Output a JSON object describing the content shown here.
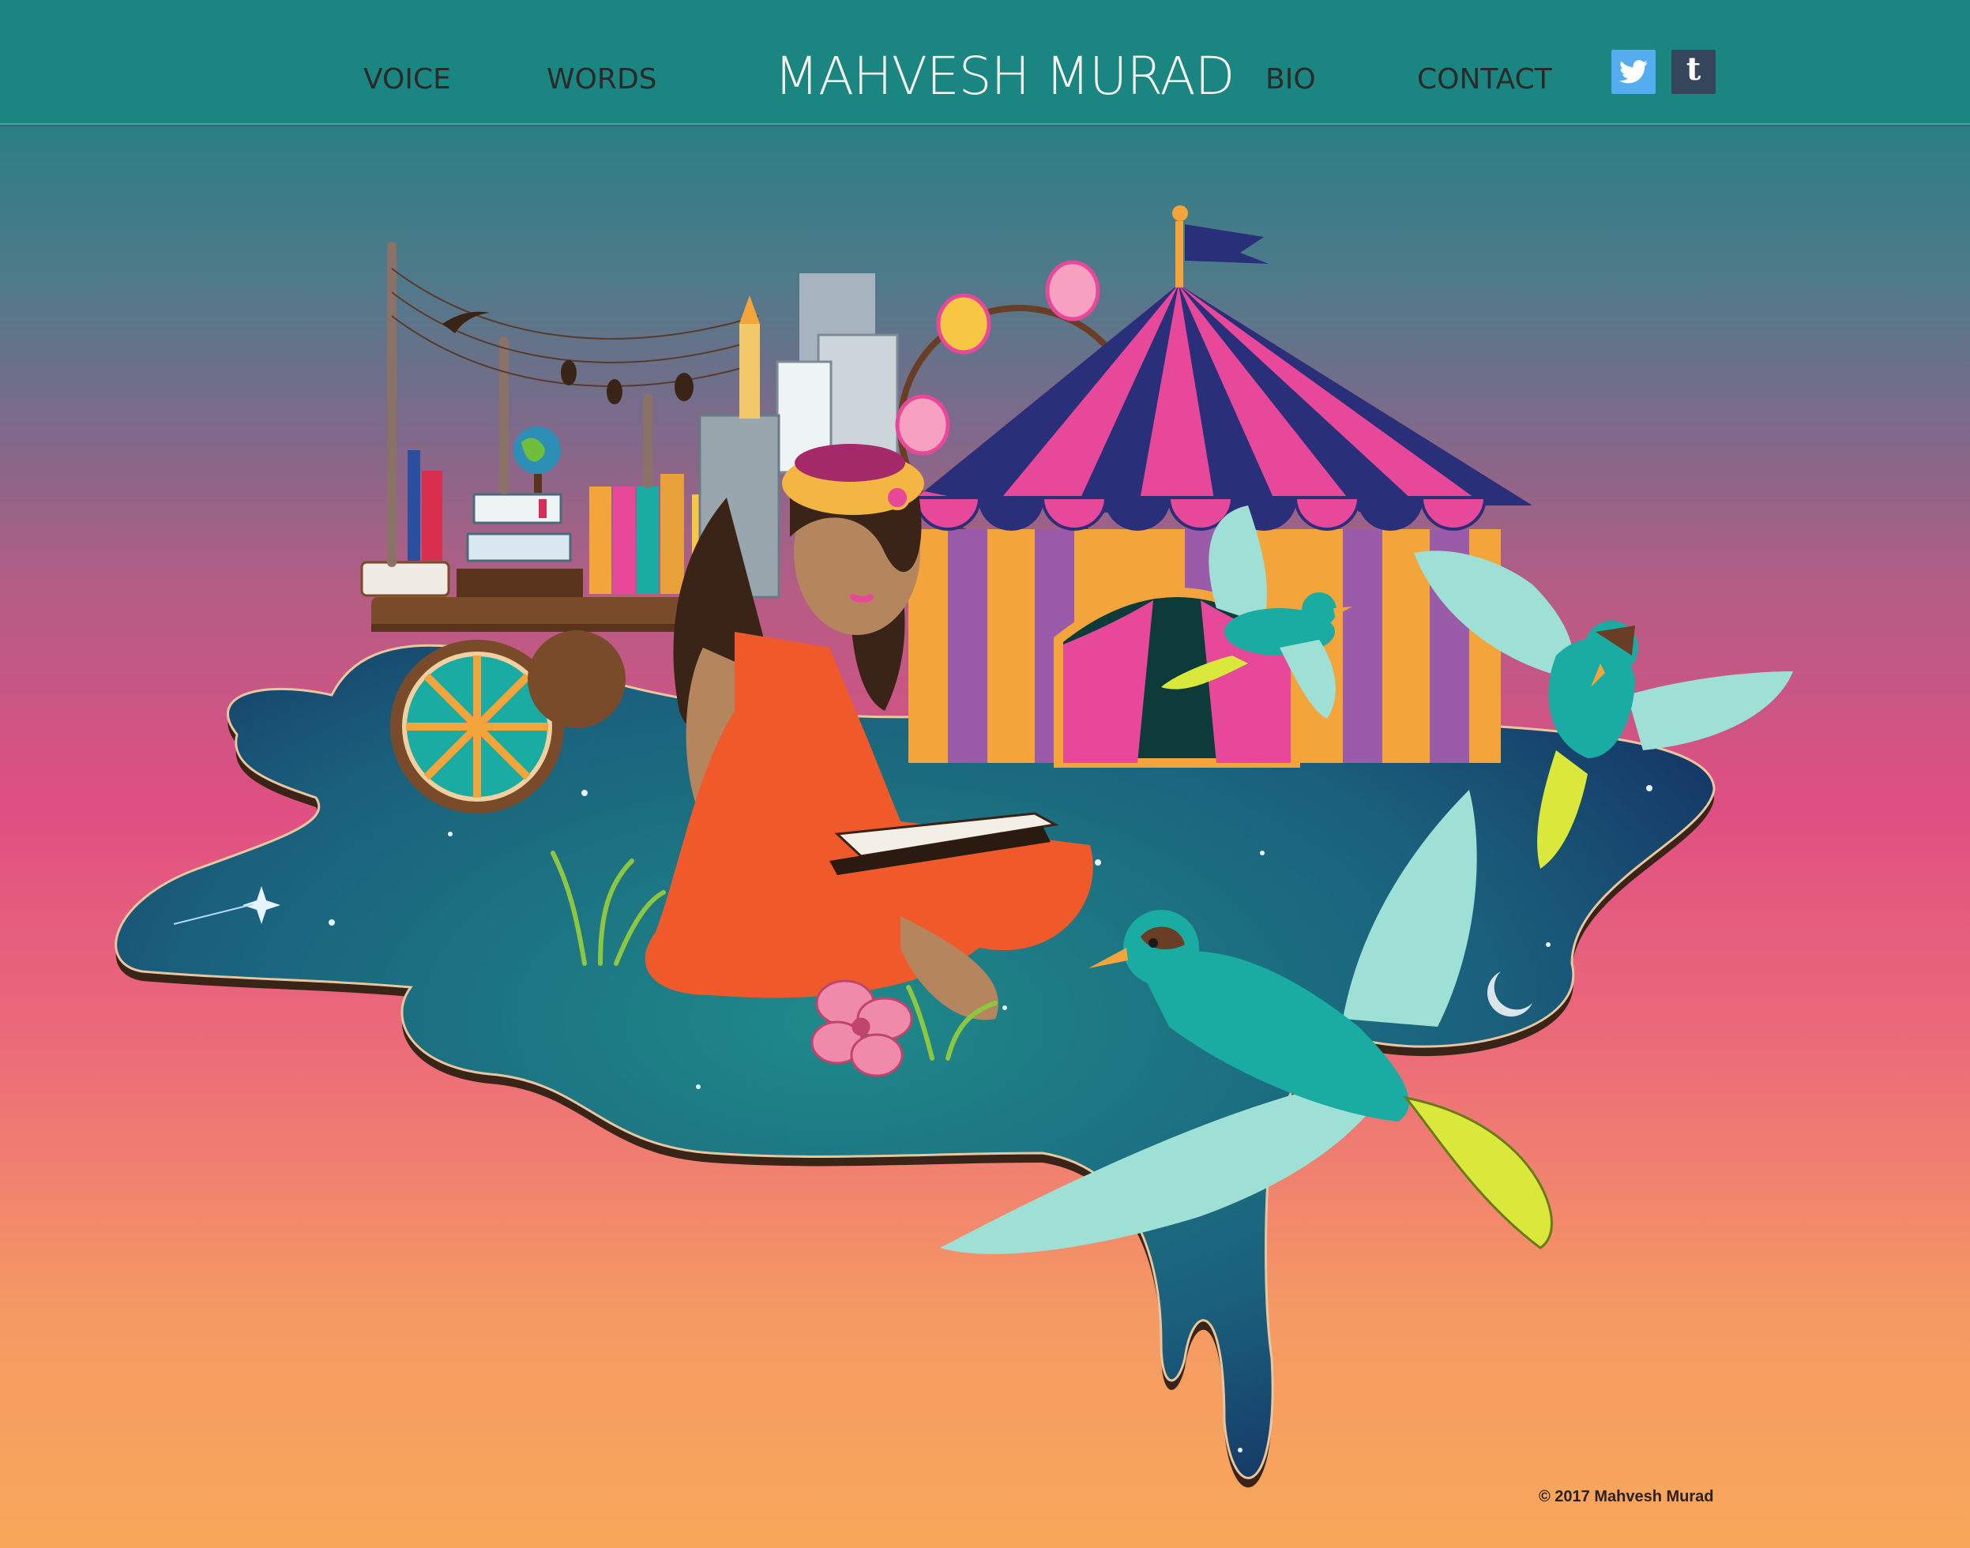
{
  "header": {
    "title": "MAHVESH MURAD",
    "nav_left": [
      {
        "label": "VOICE"
      },
      {
        "label": "WORDS"
      }
    ],
    "nav_right": [
      {
        "label": "BIO"
      },
      {
        "label": "CONTACT"
      }
    ],
    "social": [
      {
        "icon": "twitter-icon",
        "color": "#55acee"
      },
      {
        "icon": "tumblr-icon",
        "color": "#35465c",
        "glyph": "t"
      }
    ]
  },
  "hero": {
    "illustration": "woman reading on starry-sky puddle with circus tent, book cart, city skyline and birds"
  },
  "footer": {
    "copyright": "© 2017 Mahvesh Murad"
  },
  "colors": {
    "header_bg": "#1b8582",
    "gradient_top": "#2a7f83",
    "gradient_mid": "#df4f82",
    "gradient_bottom": "#f8a75a",
    "puddle": "#1b5d78",
    "tent_pink": "#e8489a",
    "tent_navy": "#2a2f7a",
    "bird_teal": "#1aaca2",
    "dress_orange": "#f05a2a"
  }
}
